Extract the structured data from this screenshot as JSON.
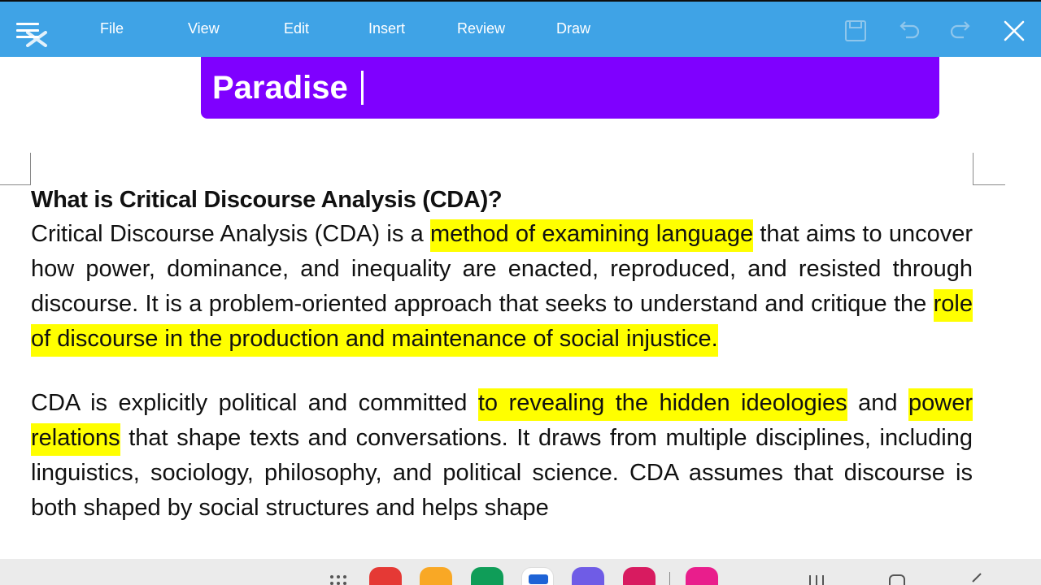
{
  "menu": {
    "items": [
      "File",
      "View",
      "Edit",
      "Insert",
      "Review",
      "Draw"
    ]
  },
  "toolbar": {
    "icons": [
      "save-icon",
      "undo-icon",
      "redo-icon",
      "close-icon"
    ]
  },
  "title_field": {
    "value": "Paradise"
  },
  "document": {
    "heading": "What is Critical Discourse Analysis (CDA)?",
    "para1": {
      "t1": "Critical Discourse Analysis (CDA) is a ",
      "h1": "method of examining language",
      "t2": " that aims to uncover how power, dominance, and inequality are enacted, reproduced, and resisted through discourse. It is a problem-oriented approach that seeks to understand and critique the ",
      "h2": "role of discourse in the production and maintenance of social injustice."
    },
    "para2": {
      "t1": "CDA is explicitly political and committed ",
      "h1": "to revealing the hidden ideologies",
      "t2": " and ",
      "h2": "power relations",
      "t3": " that shape texts and conversations. It draws from multiple disciplines, including linguistics, sociology, philosophy, and political science. CDA assumes that discourse is both shaped by social structures and helps shape"
    }
  },
  "colors": {
    "toolbar_bg": "#3fa3e6",
    "banner_bg": "#7f00ff",
    "highlight": "#ffff00",
    "taskbar_bg": "#ebebeb"
  },
  "taskbar": {
    "apps": [
      "apps-grid-icon",
      "red-app-icon",
      "files-app-icon",
      "green-app-icon",
      "blue-app-icon",
      "purple-app-icon",
      "camera-app-icon",
      "flower-app-icon"
    ],
    "nav": [
      "recents-icon",
      "home-icon",
      "back-icon"
    ]
  }
}
